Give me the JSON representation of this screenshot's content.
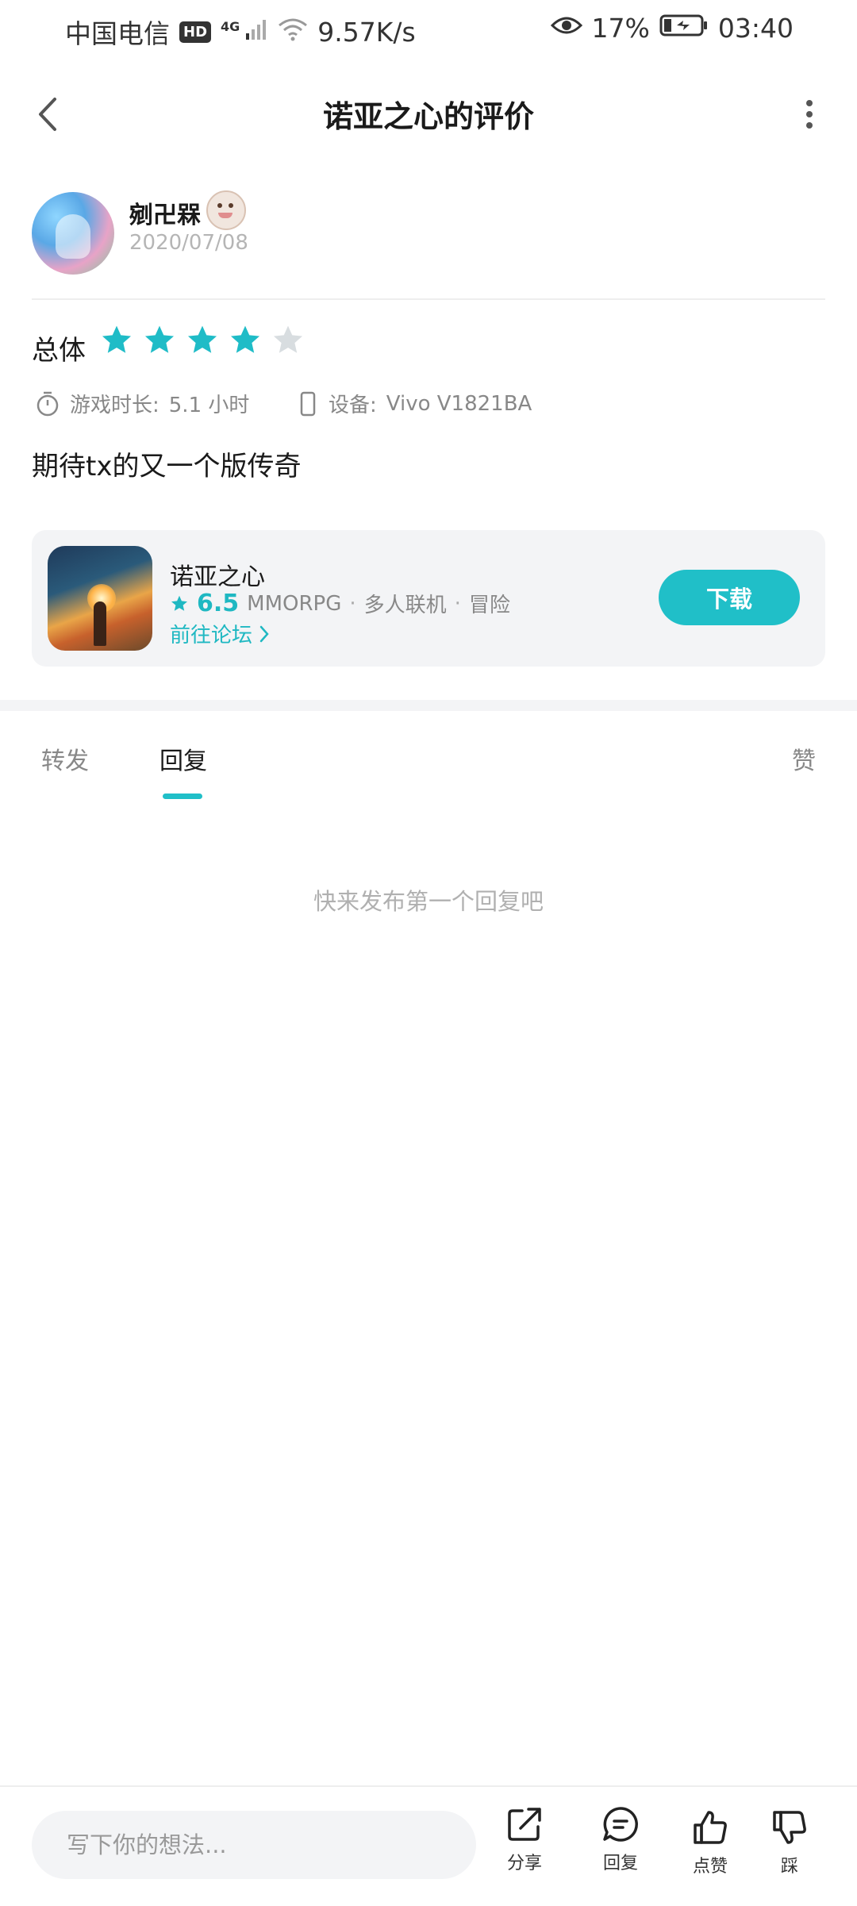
{
  "status_bar": {
    "carrier": "中国电信",
    "hd": "HD",
    "network_type": "4G",
    "speed": "9.57K/s",
    "battery": "17%",
    "time": "03:40"
  },
  "header": {
    "title": "诺亚之心的评价"
  },
  "user": {
    "name": "剜卍槑",
    "date": "2020/07/08"
  },
  "rating": {
    "label": "总体",
    "value": 4,
    "max": 5,
    "filled_color": "#1fbcc7",
    "empty_color": "#d8dde0"
  },
  "meta": {
    "play_time_label": "游戏时长:",
    "play_time_value": "5.1 小时",
    "device_label": "设备:",
    "device_value": "Vivo V1821BA"
  },
  "review": {
    "text": "期待tx的又一个版传奇"
  },
  "game": {
    "name": "诺亚之心",
    "score": "6.5",
    "tags": [
      "MMORPG",
      "多人联机",
      "冒险"
    ],
    "forum_link": "前往论坛",
    "download_label": "下载"
  },
  "tabs": [
    {
      "label": "转发"
    },
    {
      "label": "回复",
      "active": true
    },
    {
      "label": "赞"
    }
  ],
  "empty_state": "快来发布第一个回复吧",
  "bottom_bar": {
    "input_placeholder": "写下你的想法...",
    "share_label": "分享",
    "reply_label": "回复",
    "like_label": "点赞",
    "dislike_label": "踩"
  },
  "colors": {
    "accent": "#20bfc8"
  }
}
